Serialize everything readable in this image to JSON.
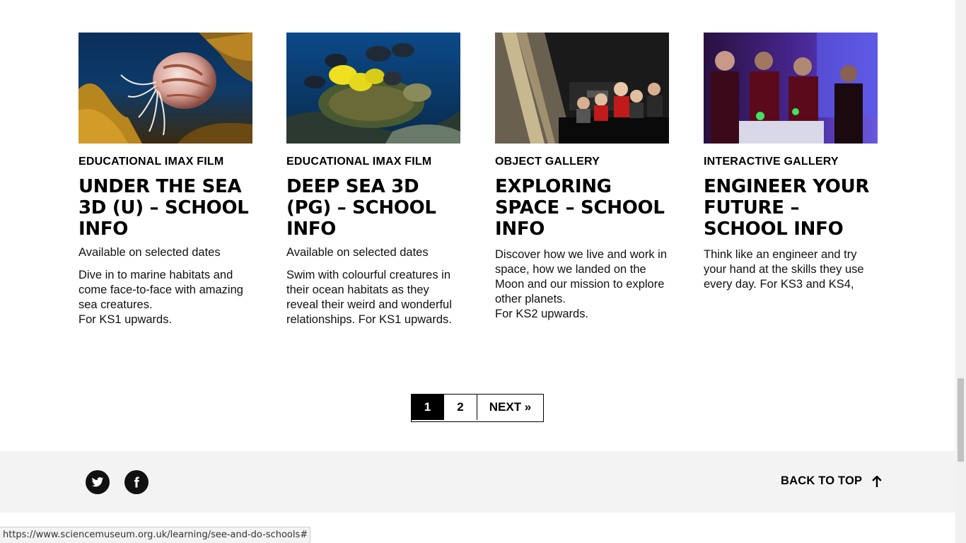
{
  "cards": [
    {
      "type": "Educational IMAX film",
      "title": "Under the Sea 3D (U) – School info",
      "availability": "Available on selected dates",
      "description": "Dive in to marine habitats and come face-to-face with amazing sea creatures.\nFor KS1 upwards.",
      "image_icon": "nautilus-photo"
    },
    {
      "type": "Educational IMAX film",
      "title": "Deep Sea 3D (PG) – School info",
      "availability": "Available on selected dates",
      "description": "Swim with colourful creatures in their ocean habitats as they reveal their weird and wonderful relationships. For KS1 upwards.",
      "image_icon": "sea-turtle-photo"
    },
    {
      "type": "Object gallery",
      "title": "Exploring Space – School info",
      "description": "Discover how we live and work in space, how we landed on the Moon and our mission to explore other planets.\nFor KS2 upwards.",
      "image_icon": "school-children-gallery-photo"
    },
    {
      "type": "Interactive gallery",
      "title": "Engineer Your Future – School info",
      "description": "Think like an engineer and try your hand at the skills they use every day. For KS3 and KS4,",
      "image_icon": "students-interactive-photo"
    }
  ],
  "pagination": {
    "page1": "1",
    "page2": "2",
    "next": "NEXT »",
    "current_page": 1
  },
  "footer": {
    "social": [
      "twitter-icon",
      "facebook-icon"
    ],
    "back_to_top": "BACK TO TOP",
    "back_to_top_icon": "arrow-up-icon"
  },
  "status_url": "https://www.sciencemuseum.org.uk/learning/see-and-do-schools#"
}
